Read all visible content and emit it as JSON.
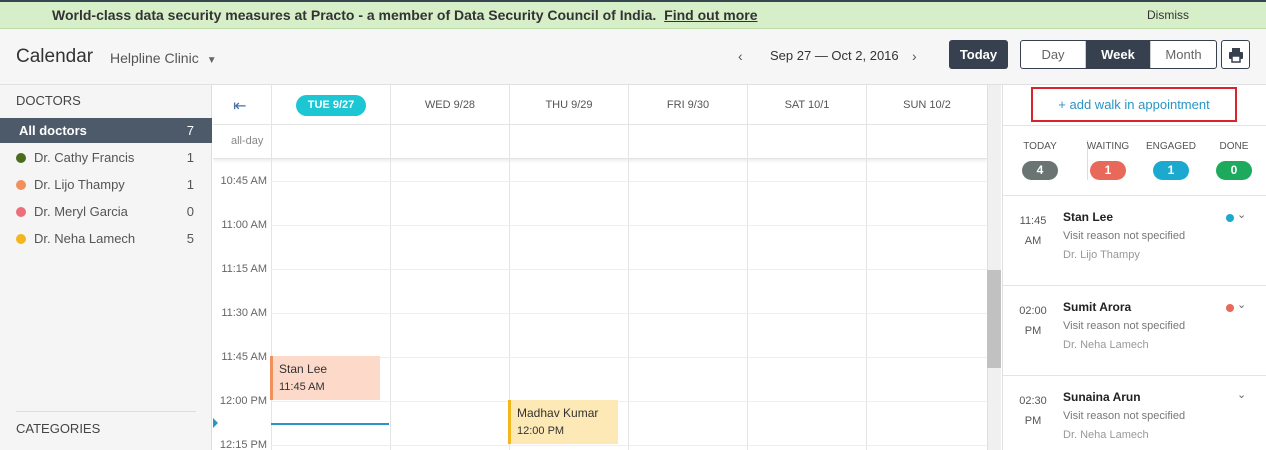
{
  "banner": {
    "message": "World-class data security measures at Practo - a member of Data Security Council of India.",
    "link": "Find out more",
    "dismiss": "Dismiss"
  },
  "header": {
    "title": "Calendar",
    "clinic": "Helpline Clinic",
    "prev_icon": "chevron-left-icon",
    "next_icon": "chevron-right-icon",
    "date_range": "Sep 27 — Oct 2, 2016",
    "today_label": "Today",
    "views": [
      "Day",
      "Week",
      "Month"
    ],
    "active_view": "Week",
    "print_icon": "printer-icon"
  },
  "sidebar": {
    "doctors_heading": "DOCTORS",
    "all_doctors": {
      "label": "All doctors",
      "count": "7"
    },
    "doctors": [
      {
        "name": "Dr. Cathy Francis",
        "count": "1",
        "color": "#4d6b1f"
      },
      {
        "name": "Dr. Lijo Thampy",
        "count": "1",
        "color": "#f0915c"
      },
      {
        "name": "Dr. Meryl Garcia",
        "count": "0",
        "color": "#ec6e7a"
      },
      {
        "name": "Dr. Neha Lamech",
        "count": "5",
        "color": "#f3b61d"
      }
    ],
    "categories_heading": "CATEGORIES"
  },
  "calendar": {
    "days": [
      "TUE 9/27",
      "WED 9/28",
      "THU 9/29",
      "FRI 9/30",
      "SAT 10/1",
      "SUN 10/2"
    ],
    "today_index": 0,
    "allday_label": "all-day",
    "time_labels": [
      "10:45 AM",
      "11:00 AM",
      "11:15 AM",
      "11:30 AM",
      "11:45 AM",
      "12:00 PM",
      "12:15 PM"
    ],
    "events": [
      {
        "name": "Stan Lee",
        "time": "11:45 AM",
        "bg": "#fcd9c8",
        "border": "#f0915c"
      },
      {
        "name": "Madhav Kumar",
        "time": "12:00 PM",
        "bg": "#fde9b5",
        "border": "#f3b61d"
      }
    ]
  },
  "right_panel": {
    "walkin_label": "+ add walk in appointment",
    "stats": [
      {
        "label": "TODAY",
        "value": "4",
        "color": "#6a7573"
      },
      {
        "label": "WAITING",
        "value": "1",
        "color": "#e8685a"
      },
      {
        "label": "ENGAGED",
        "value": "1",
        "color": "#1ba9d0"
      },
      {
        "label": "DONE",
        "value": "0",
        "color": "#1daa5c"
      }
    ],
    "appointments": [
      {
        "time": "11:45",
        "ampm": "AM",
        "name": "Stan Lee",
        "reason": "Visit reason not specified",
        "doctor": "Dr. Lijo Thampy",
        "status_color": "#1ba9d0"
      },
      {
        "time": "02:00",
        "ampm": "PM",
        "name": "Sumit Arora",
        "reason": "Visit reason not specified",
        "doctor": "Dr. Neha Lamech",
        "status_color": "#e8685a"
      },
      {
        "time": "02:30",
        "ampm": "PM",
        "name": "Sunaina Arun",
        "reason": "Visit reason not specified",
        "doctor": "Dr. Neha Lamech",
        "status_color": ""
      }
    ]
  }
}
